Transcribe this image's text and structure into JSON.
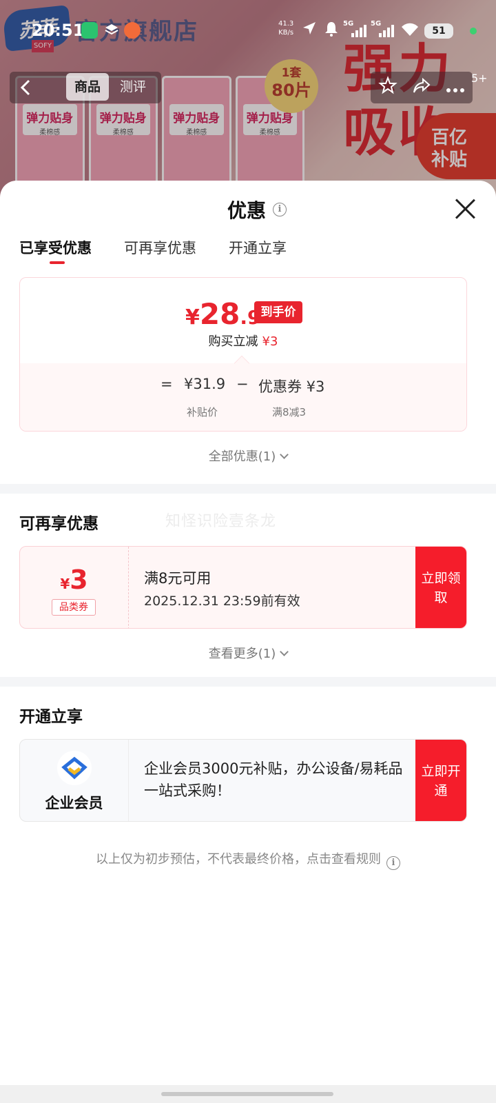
{
  "status_bar": {
    "time": "20:51",
    "net_speed": "41.3",
    "net_unit": "KB/s",
    "sig1_label": "5G",
    "sig2_label": "5G",
    "battery": "51"
  },
  "background_page": {
    "brand_logo": "苏菲",
    "brand_sub": "SOFY",
    "store_name": "官方旗舰店",
    "pack_title": "弹力贴身",
    "pack_sub": "柔棉感",
    "pack_badge_1": "1套",
    "pack_badge_2": "80片",
    "promo_text_1": "强力",
    "promo_text_2": "吸收",
    "subsidy_1": "百亿",
    "subsidy_2": "补贴",
    "nav_tab_goods": "商品",
    "nav_tab_review": "测评",
    "msg_count": "5+"
  },
  "sheet": {
    "title": "优惠",
    "tabs": [
      {
        "label": "已享受优惠",
        "active": true
      },
      {
        "label": "可再享优惠",
        "active": false
      },
      {
        "label": "开通立享",
        "active": false
      }
    ],
    "price_card": {
      "currency": "¥",
      "price_int": "28",
      "price_dec": ".9",
      "tag": "到手价",
      "reduce_label": "购买立减",
      "reduce_value": "¥3",
      "eq": "=",
      "subsidy_price": "¥31.9",
      "minus": "−",
      "coupon_text": "优惠券 ¥3",
      "subsidy_price_label": "补贴价",
      "coupon_rule": "满8减3"
    },
    "all_offers": "全部优惠(1)",
    "more_section": {
      "title": "可再享优惠",
      "watermark": "知怪识险壹条龙",
      "coupon": {
        "currency": "¥",
        "amount": "3",
        "type": "品类券",
        "condition": "满8元可用",
        "validity": "2025.12.31 23:59前有效",
        "button": "立即领取"
      },
      "see_more": "查看更多(1)"
    },
    "open_section": {
      "title": "开通立享",
      "member": {
        "label": "企业会员",
        "desc": "企业会员3000元补贴，办公设备/易耗品一站式采购！",
        "button": "立即开通"
      }
    },
    "disclaimer": "以上仅为初步预估，不代表最终价格，点击查看规则"
  },
  "colors": {
    "accent_red": "#e8242e",
    "button_red": "#f51d2b",
    "coupon_bg": "#fff6f6"
  }
}
